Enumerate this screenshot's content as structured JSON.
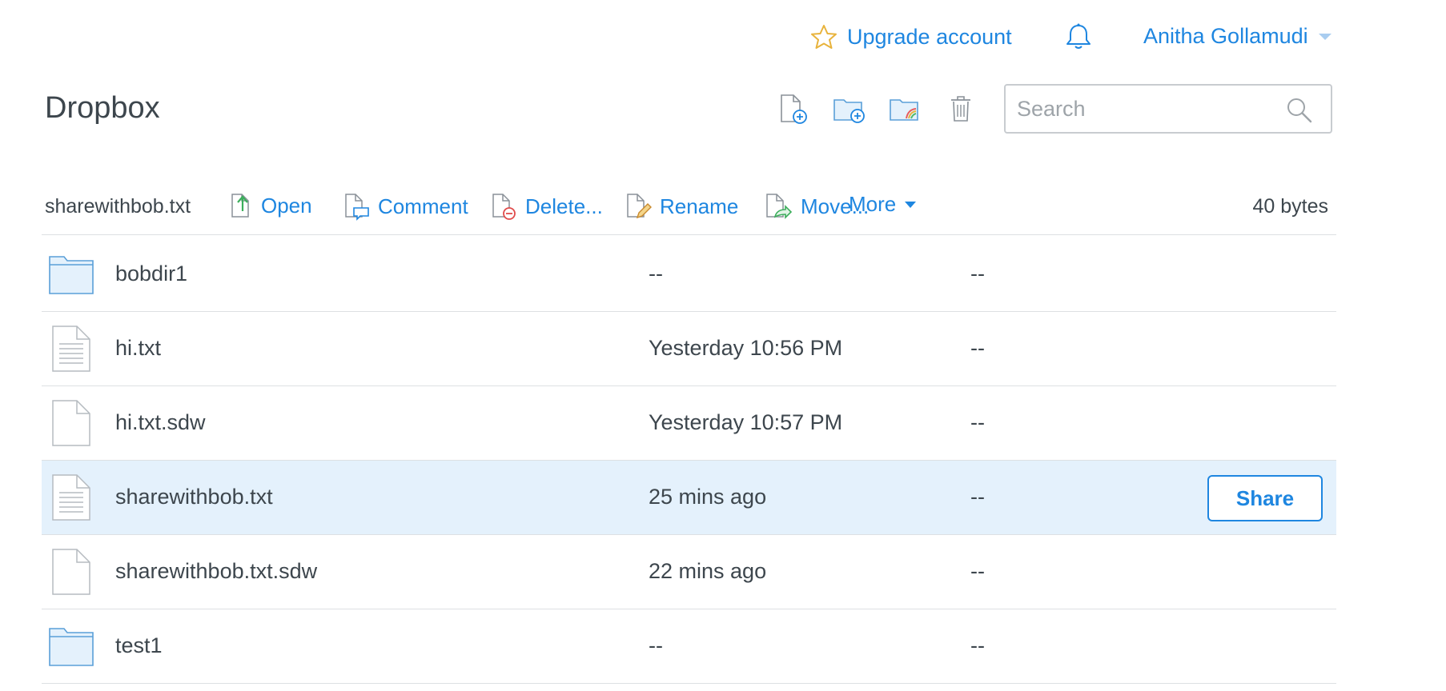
{
  "header": {
    "upgrade_label": "Upgrade account",
    "user_name": "Anitha Gollamudi",
    "page_title": "Dropbox",
    "search_placeholder": "Search"
  },
  "toolbar_icons": [
    "new-file-icon",
    "new-folder-icon",
    "shared-folder-icon",
    "trash-icon"
  ],
  "action_bar": {
    "selected_name": "sharewithbob.txt",
    "actions": {
      "open": "Open",
      "comment": "Comment",
      "delete": "Delete...",
      "rename": "Rename",
      "move": "Move...",
      "more": "More"
    },
    "size": "40 bytes"
  },
  "files": [
    {
      "name": "bobdir1",
      "type": "folder",
      "modified": "--",
      "shared": "--"
    },
    {
      "name": "hi.txt",
      "type": "text",
      "modified": "Yesterday 10:56 PM",
      "shared": "--"
    },
    {
      "name": "hi.txt.sdw",
      "type": "blank",
      "modified": "Yesterday 10:57 PM",
      "shared": "--"
    },
    {
      "name": "sharewithbob.txt",
      "type": "text",
      "modified": "25 mins ago",
      "shared": "--",
      "selected": true,
      "share_label": "Share"
    },
    {
      "name": "sharewithbob.txt.sdw",
      "type": "blank",
      "modified": "22 mins ago",
      "shared": "--"
    },
    {
      "name": "test1",
      "type": "folder",
      "modified": "--",
      "shared": "--"
    }
  ],
  "colors": {
    "accent": "#1e86e0",
    "selected_row": "#e4f1fc",
    "text": "#3d464d",
    "star": "#e8b33c"
  }
}
